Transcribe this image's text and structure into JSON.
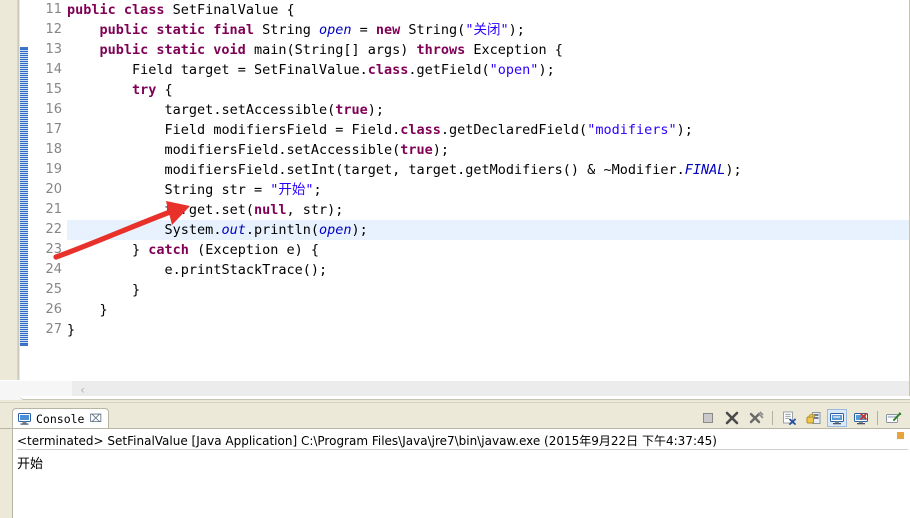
{
  "editor": {
    "first_visible_line": 11,
    "highlighted_line": 22,
    "fold_marker_line": 13,
    "lines": [
      {
        "no": "11",
        "tokens": [
          {
            "t": "kw",
            "s": "public class "
          },
          {
            "t": "plain",
            "s": "SetFinalValue {"
          }
        ],
        "indent": 0
      },
      {
        "no": "12",
        "tokens": [
          {
            "t": "kw",
            "s": "public static final "
          },
          {
            "t": "plain",
            "s": "String "
          },
          {
            "t": "fld",
            "s": "open"
          },
          {
            "t": "plain",
            "s": " = "
          },
          {
            "t": "kw",
            "s": "new "
          },
          {
            "t": "plain",
            "s": "String("
          },
          {
            "t": "str",
            "s": "\"关闭\""
          },
          {
            "t": "plain",
            "s": ");"
          }
        ],
        "indent": 1
      },
      {
        "no": "13",
        "tokens": [
          {
            "t": "kw",
            "s": "public static void "
          },
          {
            "t": "plain",
            "s": "main(String[] args) "
          },
          {
            "t": "kw",
            "s": "throws "
          },
          {
            "t": "plain",
            "s": "Exception {"
          }
        ],
        "indent": 1
      },
      {
        "no": "14",
        "tokens": [
          {
            "t": "plain",
            "s": "Field target = SetFinalValue."
          },
          {
            "t": "kw",
            "s": "class"
          },
          {
            "t": "plain",
            "s": ".getField("
          },
          {
            "t": "str",
            "s": "\"open\""
          },
          {
            "t": "plain",
            "s": ");"
          }
        ],
        "indent": 2
      },
      {
        "no": "15",
        "tokens": [
          {
            "t": "kw",
            "s": "try "
          },
          {
            "t": "plain",
            "s": "{"
          }
        ],
        "indent": 2
      },
      {
        "no": "16",
        "tokens": [
          {
            "t": "plain",
            "s": "target.setAccessible("
          },
          {
            "t": "kw",
            "s": "true"
          },
          {
            "t": "plain",
            "s": ");"
          }
        ],
        "indent": 3
      },
      {
        "no": "17",
        "tokens": [
          {
            "t": "plain",
            "s": "Field modifiersField = Field."
          },
          {
            "t": "kw",
            "s": "class"
          },
          {
            "t": "plain",
            "s": ".getDeclaredField("
          },
          {
            "t": "str",
            "s": "\"modifiers\""
          },
          {
            "t": "plain",
            "s": ");"
          }
        ],
        "indent": 3
      },
      {
        "no": "18",
        "tokens": [
          {
            "t": "plain",
            "s": "modifiersField.setAccessible("
          },
          {
            "t": "kw",
            "s": "true"
          },
          {
            "t": "plain",
            "s": ");"
          }
        ],
        "indent": 3
      },
      {
        "no": "19",
        "tokens": [
          {
            "t": "plain",
            "s": "modifiersField.setInt(target, target.getModifiers() & ~Modifier."
          },
          {
            "t": "sfld",
            "s": "FINAL"
          },
          {
            "t": "plain",
            "s": ");"
          }
        ],
        "indent": 3
      },
      {
        "no": "20",
        "tokens": [
          {
            "t": "plain",
            "s": "String str = "
          },
          {
            "t": "str",
            "s": "\"开始\""
          },
          {
            "t": "plain",
            "s": ";"
          }
        ],
        "indent": 3
      },
      {
        "no": "21",
        "tokens": [
          {
            "t": "plain",
            "s": "target.set("
          },
          {
            "t": "kw",
            "s": "null"
          },
          {
            "t": "plain",
            "s": ", str);"
          }
        ],
        "indent": 3
      },
      {
        "no": "22",
        "tokens": [
          {
            "t": "plain",
            "s": "System."
          },
          {
            "t": "sfld",
            "s": "out"
          },
          {
            "t": "plain",
            "s": ".println("
          },
          {
            "t": "fld",
            "s": "open"
          },
          {
            "t": "plain",
            "s": ");"
          }
        ],
        "indent": 3
      },
      {
        "no": "23",
        "tokens": [
          {
            "t": "plain",
            "s": "} "
          },
          {
            "t": "kw",
            "s": "catch "
          },
          {
            "t": "plain",
            "s": "(Exception e) {"
          }
        ],
        "indent": 2
      },
      {
        "no": "24",
        "tokens": [
          {
            "t": "plain",
            "s": "e.printStackTrace();"
          }
        ],
        "indent": 3
      },
      {
        "no": "25",
        "tokens": [
          {
            "t": "plain",
            "s": "}"
          }
        ],
        "indent": 2
      },
      {
        "no": "26",
        "tokens": [
          {
            "t": "plain",
            "s": "}"
          }
        ],
        "indent": 1
      },
      {
        "no": "27",
        "tokens": [
          {
            "t": "plain",
            "s": "}"
          }
        ],
        "indent": 0
      }
    ],
    "hscroll_arrow": "‹",
    "annotation_arrow": {
      "color": "#e8312a",
      "points_to_line": 20
    }
  },
  "console": {
    "tab_label": "Console",
    "tab_close_glyph": "⌧",
    "header": "<terminated> SetFinalValue [Java Application] C:\\Program Files\\Java\\jre7\\bin\\javaw.exe (2015年9月22日 下午4:37:45)",
    "output": "开始",
    "toolbar": [
      {
        "name": "terminate-button",
        "title": "Terminate"
      },
      {
        "name": "remove-launch-button",
        "title": "Remove Launch"
      },
      {
        "name": "remove-all-terminated-button",
        "title": "Remove All Terminated Launches"
      },
      {
        "name": "clear-console-button",
        "title": "Clear Console"
      },
      {
        "name": "scroll-lock-button",
        "title": "Scroll Lock"
      },
      {
        "name": "pin-console-button",
        "title": "Pin Console"
      },
      {
        "name": "display-selected-console-button",
        "title": "Display Selected Console"
      },
      {
        "name": "open-console-button",
        "title": "Open Console"
      }
    ]
  },
  "colors": {
    "keyword": "#7f0055",
    "string": "#2a00ff",
    "field": "#0000c0",
    "highlight_line": "#e8f2fe",
    "chrome": "#ece9d8",
    "arrow_red": "#e8312a",
    "fold_blue": "#3d76c9"
  }
}
